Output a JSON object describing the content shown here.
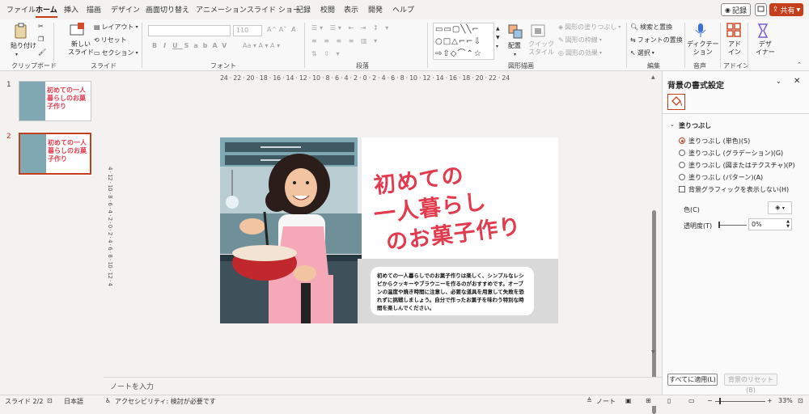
{
  "menu": {
    "tabs": [
      "ファイル",
      "ホーム",
      "挿入",
      "描画",
      "デザイン",
      "画面切り替え",
      "アニメーション",
      "スライド ショー",
      "記録",
      "校閲",
      "表示",
      "開発",
      "ヘルプ"
    ],
    "record": "記録",
    "share": "共有"
  },
  "ribbon": {
    "clipboard": {
      "paste": "貼り付け",
      "label": "クリップボード"
    },
    "slides": {
      "new_slide_1": "新しい",
      "new_slide_2": "スライド",
      "layout": "レイアウト",
      "reset": "リセット",
      "section": "セクション",
      "label": "スライド"
    },
    "font": {
      "size": "110",
      "label": "フォント"
    },
    "paragraph": {
      "label": "段落"
    },
    "drawing": {
      "arrange": "配置",
      "quick_style_1": "クイック",
      "quick_style_2": "スタイル",
      "shape_fill": "図形の塗りつぶし",
      "shape_outline": "図形の枠線",
      "shape_effects": "図形の効果",
      "label": "図形描画"
    },
    "editing": {
      "find": "検索と置換",
      "replace_font": "フォントの置換",
      "select": "選択",
      "label": "編集"
    },
    "voice": {
      "dictation_1": "ディクテー",
      "dictation_2": "ション",
      "label": "音声"
    },
    "addins": {
      "addin_1": "アド",
      "addin_2": "イン",
      "label": "アドイン"
    },
    "designer": {
      "d1": "デザ",
      "d2": "イナー"
    }
  },
  "thumbnails": [
    {
      "num": "1"
    },
    {
      "num": "2"
    }
  ],
  "ruler_h": "24 · 22 · 20 · 18 · 16 · 14 · 12 · 10 · 8 · 6 · 4 · 2 · 0 · 2 · 4 · 6 · 8 · 10 · 12 · 14 · 16 · 18 · 20 · 22 · 24",
  "ruler_v": "4 · 12 · 10 · 8 · 6 · 4 · 2 · 0 · 2 · 4 · 6 · 8 · 10 · 12 · 4",
  "slide": {
    "title_lines": [
      "初めての",
      "一人暮らし",
      "のお菓子作り"
    ],
    "body": "初めての一人暮らしでのお菓子作りは楽しく、シンプルなレシピからクッキーやブラウニーを作るのがおすすめです。オーブンの温度や焼き時間に注意し、必要な道具を用意して失敗を恐れずに挑戦しましょう。自分で作ったお菓子を味わう特別な時間を楽しんでください。"
  },
  "thumb_title": "初めての一人暮らしのお菓子作り",
  "notes_placeholder": "ノートを入力",
  "pane": {
    "title": "背景の書式設定",
    "section": "塗りつぶし",
    "options": [
      "塗りつぶし (単色)(S)",
      "塗りつぶし (グラデーション)(G)",
      "塗りつぶし (図またはテクスチャ)(P)",
      "塗りつぶし (パターン)(A)"
    ],
    "hide_bg": "背景グラフィックを表示しない(H)",
    "color": "色(C)",
    "transparency": "透明度(T)",
    "transparency_value": "0%",
    "apply_all": "すべてに適用(L)",
    "reset_bg": "背景のリセット(B)"
  },
  "status": {
    "slide": "スライド 2/2",
    "lang": "日本語",
    "access": "アクセシビリティ: 検討が必要です",
    "notes": "ノート",
    "zoom": "33%"
  },
  "colors": {
    "accent": "#c43e1c",
    "title": "#e23b4d"
  }
}
